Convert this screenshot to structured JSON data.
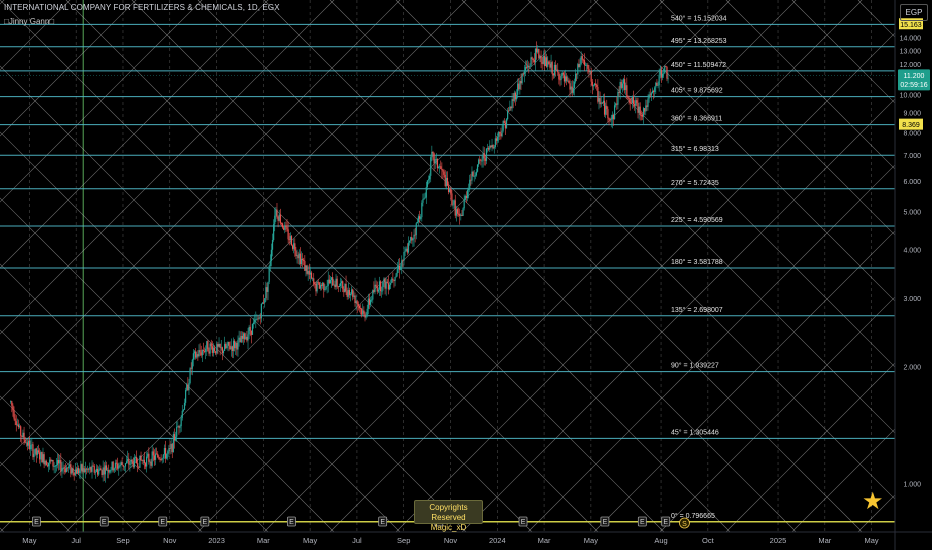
{
  "header": {
    "symbol_line": "INTERNATIONAL COMPANY FOR FERTILIZERS & CHEMICALS, 1D, EGX",
    "indicator": "□Jinny Gann□",
    "currency": "EGP"
  },
  "copyright": {
    "line1": "Copyrights Reserved",
    "line2": "Magic_xD"
  },
  "chart_data": {
    "type": "candlestick",
    "symbol": "INTERNATIONAL COMPANY FOR FERTILIZERS & CHEMICALS",
    "interval": "1D",
    "exchange": "EGX",
    "currency": "EGP",
    "ylim": [
      0.75,
      16.5
    ],
    "y_scale": "log",
    "y_ticks": [
      "1.000",
      "2.000",
      "3.000",
      "4.000",
      "5.000",
      "6.000",
      "7.000",
      "8.000",
      "9.000",
      "10.000",
      "11.000",
      "12.000",
      "13.000",
      "14.000"
    ],
    "y_tick_values": [
      1,
      2,
      3,
      4,
      5,
      6,
      7,
      8,
      9,
      10,
      11,
      12,
      13,
      14
    ],
    "x_ticks": [
      "May",
      "Jul",
      "Sep",
      "Nov",
      "2023",
      "Mar",
      "May",
      "Jul",
      "Sep",
      "Nov",
      "2024",
      "Mar",
      "May",
      "Aug",
      "Oct",
      "2025",
      "Mar",
      "May"
    ],
    "x_tick_months": [
      4,
      6,
      8,
      10,
      12,
      14,
      16,
      18,
      20,
      22,
      24,
      26,
      28,
      31,
      33,
      36,
      38,
      40
    ],
    "x_domain_months": [
      3,
      41
    ],
    "price_path": [
      [
        3.2,
        1.62
      ],
      [
        3.6,
        1.35
      ],
      [
        4.2,
        1.2
      ],
      [
        5,
        1.12
      ],
      [
        6,
        1.08
      ],
      [
        7,
        1.08
      ],
      [
        8,
        1.12
      ],
      [
        9,
        1.15
      ],
      [
        10,
        1.2
      ],
      [
        10.5,
        1.5
      ],
      [
        11,
        2.1
      ],
      [
        11.6,
        2.25
      ],
      [
        12.2,
        2.2
      ],
      [
        13,
        2.3
      ],
      [
        13.8,
        2.65
      ],
      [
        14.2,
        3.3
      ],
      [
        14.5,
        5.1
      ],
      [
        15,
        4.4
      ],
      [
        15.6,
        3.8
      ],
      [
        16.2,
        3.2
      ],
      [
        17,
        3.3
      ],
      [
        17.8,
        3.1
      ],
      [
        18.3,
        2.7
      ],
      [
        18.8,
        3.2
      ],
      [
        19.4,
        3.3
      ],
      [
        20,
        3.8
      ],
      [
        20.5,
        4.5
      ],
      [
        20.9,
        5.5
      ],
      [
        21.2,
        6.9
      ],
      [
        21.6,
        6.4
      ],
      [
        22,
        5.5
      ],
      [
        22.4,
        4.7
      ],
      [
        22.8,
        6.0
      ],
      [
        23.4,
        6.9
      ],
      [
        23.9,
        7.6
      ],
      [
        24.3,
        8.4
      ],
      [
        24.8,
        10.2
      ],
      [
        25.2,
        11.6
      ],
      [
        25.7,
        12.8
      ],
      [
        26.2,
        11.8
      ],
      [
        26.7,
        11.2
      ],
      [
        27.2,
        10.2
      ],
      [
        27.6,
        12.5
      ],
      [
        28,
        11.0
      ],
      [
        28.4,
        9.6
      ],
      [
        28.9,
        8.6
      ],
      [
        29.3,
        10.8
      ],
      [
        29.8,
        9.5
      ],
      [
        30.2,
        9.0
      ],
      [
        30.7,
        10.2
      ],
      [
        31.1,
        11.7
      ],
      [
        31.3,
        11.2
      ]
    ],
    "last_price": "11.200",
    "countdown": "02:59:16",
    "markers": [
      {
        "label": "15.163",
        "value": 15.163,
        "color": "#f2e14c"
      },
      {
        "label": "8.369",
        "value": 8.369,
        "color": "#f2e14c"
      }
    ],
    "gann_levels": [
      {
        "label": "540° = 15.152034",
        "value": 15.152034
      },
      {
        "label": "495° = 13.268253",
        "value": 13.268253
      },
      {
        "label": "450° = 11.509472",
        "value": 11.509472
      },
      {
        "label": "405° = 9.875692",
        "value": 9.875692
      },
      {
        "label": "360° = 8.366911",
        "value": 8.366911
      },
      {
        "label": "315° = 6.98313",
        "value": 6.98313
      },
      {
        "label": "270° = 5.72435",
        "value": 5.72435
      },
      {
        "label": "225° = 4.590569",
        "value": 4.590569
      },
      {
        "label": "180° = 3.581788",
        "value": 3.581788
      },
      {
        "label": "135° = 2.698007",
        "value": 2.698007
      },
      {
        "label": "90° = 1.939227",
        "value": 1.939227
      },
      {
        "label": "45° = 1.305446",
        "value": 1.305446
      },
      {
        "label": "0° = 0.796665",
        "value": 0.796665
      }
    ],
    "event_markers": [
      "E",
      "E",
      "E",
      "E",
      "E",
      "E",
      "E",
      "E",
      "E",
      "E",
      "E"
    ],
    "event_months": [
      4.3,
      7.2,
      9.7,
      11.5,
      15.2,
      19.1,
      21.5,
      25.1,
      28.6,
      30.2,
      31.2
    ],
    "dividend_marker": "S",
    "dividend_month": 32.0,
    "colors": {
      "up": "#26a69a",
      "down": "#ef5350",
      "level": "#4fb7c7",
      "zero_level": "#d8d84a",
      "grid": "#888",
      "diag": "#cfcfcf",
      "vline": "#6fd36f"
    }
  }
}
